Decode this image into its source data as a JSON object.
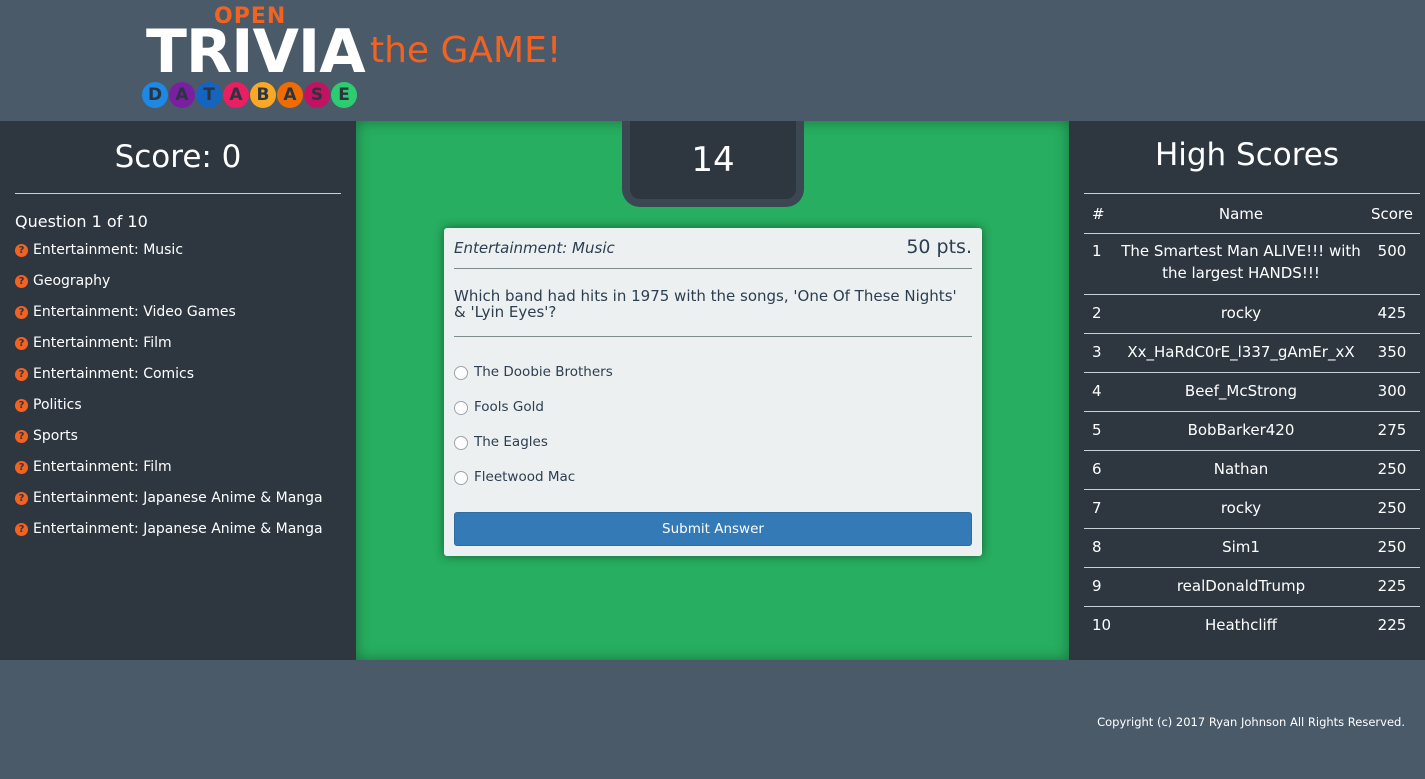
{
  "header": {
    "logo": {
      "open": "OPEN",
      "trivia": "TRIVIA",
      "database_letters": [
        "D",
        "A",
        "T",
        "A",
        "B",
        "A",
        "S",
        "E"
      ],
      "database_colors": [
        "#1e88e5",
        "#7b1fa2",
        "#1565c0",
        "#e91e63",
        "#f9a825",
        "#ef6c00",
        "#c51162",
        "#2ecc71"
      ]
    },
    "tagline": "the GAME!"
  },
  "sidebar": {
    "score_text": "Score: 0",
    "question_count": "Question 1 of 10",
    "questions": [
      {
        "icon": "question-icon",
        "label": "Entertainment: Music"
      },
      {
        "icon": "question-icon",
        "label": "Geography"
      },
      {
        "icon": "question-icon",
        "label": "Entertainment: Video Games"
      },
      {
        "icon": "question-icon",
        "label": "Entertainment: Film"
      },
      {
        "icon": "question-icon",
        "label": "Entertainment: Comics"
      },
      {
        "icon": "question-icon",
        "label": "Politics"
      },
      {
        "icon": "question-icon",
        "label": "Sports"
      },
      {
        "icon": "question-icon",
        "label": "Entertainment: Film"
      },
      {
        "icon": "question-icon",
        "label": "Entertainment: Japanese Anime & Manga"
      },
      {
        "icon": "question-icon",
        "label": "Entertainment: Japanese Anime & Manga"
      }
    ]
  },
  "timer": {
    "value": "14"
  },
  "question_card": {
    "category": "Entertainment: Music",
    "points": "50 pts.",
    "question": "Which band had hits in 1975 with the songs, 'One Of These Nights' & 'Lyin Eyes'?",
    "answers": [
      "The Doobie Brothers",
      "Fools Gold",
      "The Eagles",
      "Fleetwood Mac"
    ],
    "submit_label": "Submit Answer"
  },
  "high_scores": {
    "title": "High Scores",
    "headers": {
      "num": "#",
      "name": "Name",
      "score": "Score"
    },
    "rows": [
      {
        "num": "1",
        "name": "The Smartest Man ALIVE!!! with the largest HANDS!!!",
        "score": "500"
      },
      {
        "num": "2",
        "name": "rocky",
        "score": "425"
      },
      {
        "num": "3",
        "name": "Xx_HaRdC0rE_l337_gAmEr_xX",
        "score": "350"
      },
      {
        "num": "4",
        "name": "Beef_McStrong",
        "score": "300"
      },
      {
        "num": "5",
        "name": "BobBarker420",
        "score": "275"
      },
      {
        "num": "6",
        "name": "Nathan",
        "score": "250"
      },
      {
        "num": "7",
        "name": "rocky",
        "score": "250"
      },
      {
        "num": "8",
        "name": "Sim1",
        "score": "250"
      },
      {
        "num": "9",
        "name": "realDonaldTrump",
        "score": "225"
      },
      {
        "num": "10",
        "name": "Heathcliff",
        "score": "225"
      }
    ]
  },
  "footer": {
    "copyright": "Copyright (c) 2017 Ryan Johnson All Rights Reserved."
  },
  "colors": {
    "accent_orange": "#f26322",
    "center_green": "#27ae60",
    "panel_dark": "#2e3740",
    "header_bg": "#4a5a69",
    "button_blue": "#337ab7"
  }
}
